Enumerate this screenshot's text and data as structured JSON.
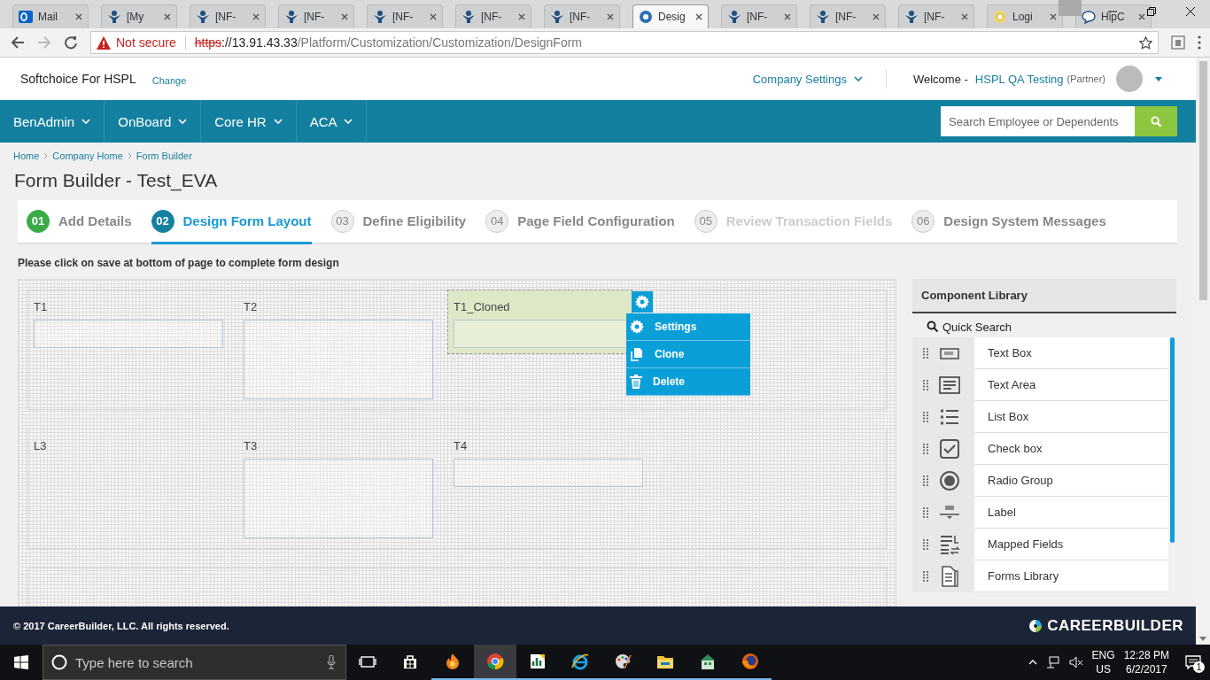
{
  "browser": {
    "tabs": [
      {
        "label": "Mail",
        "kind": "mail",
        "selected": false
      },
      {
        "label": "[My",
        "kind": "tracker",
        "selected": false
      },
      {
        "label": "[NF-",
        "kind": "tracker",
        "selected": false
      },
      {
        "label": "[NF-",
        "kind": "tracker",
        "selected": false
      },
      {
        "label": "[NF-",
        "kind": "tracker",
        "selected": false
      },
      {
        "label": "[NF-",
        "kind": "tracker",
        "selected": false
      },
      {
        "label": "[NF-",
        "kind": "tracker",
        "selected": false
      },
      {
        "label": "Desig",
        "kind": "site",
        "selected": true
      },
      {
        "label": "[NF-",
        "kind": "tracker",
        "selected": false
      },
      {
        "label": "[NF-",
        "kind": "tracker",
        "selected": false
      },
      {
        "label": "[NF-",
        "kind": "tracker",
        "selected": false
      },
      {
        "label": "Logi",
        "kind": "login",
        "selected": false
      },
      {
        "label": "HipC",
        "kind": "chat",
        "selected": false
      }
    ],
    "security": "Not secure",
    "url_scheme": "https",
    "url_host": "://13.91.43.33",
    "url_path": "/Platform/Customization/Customization/DesignForm"
  },
  "header": {
    "company": "Softchoice For HSPL",
    "change": "Change",
    "company_settings": "Company Settings",
    "welcome": "Welcome -",
    "user": "HSPL QA Testing",
    "role": "(Partner)"
  },
  "nav": {
    "items": [
      "BenAdmin",
      "OnBoard",
      "Core HR",
      "ACA"
    ],
    "search_placeholder": "Search Employee or Dependents"
  },
  "breadcrumb": [
    "Home",
    "Company Home",
    "Form Builder"
  ],
  "page_title": "Form Builder - Test_EVA",
  "steps": [
    {
      "number": "01",
      "label": "Add Details",
      "kind": "complete",
      "selected": false
    },
    {
      "number": "02",
      "label": "Design Form Layout",
      "kind": "current",
      "selected": true
    },
    {
      "number": "03",
      "label": "Define Eligibility",
      "kind": "pending",
      "selected": false
    },
    {
      "number": "04",
      "label": "Page Field Configuration",
      "kind": "pending",
      "selected": false
    },
    {
      "number": "05",
      "label": "Review Transaction Fields",
      "kind": "disabled",
      "selected": false
    },
    {
      "number": "06",
      "label": "Design System Messages",
      "kind": "pending",
      "selected": false
    }
  ],
  "instruction": "Please click on save at bottom of page to complete form design",
  "canvas": {
    "rows": [
      {
        "kind": "fields",
        "fields": [
          {
            "label": "T1",
            "kind": "textbox",
            "selected": false
          },
          {
            "label": "T2",
            "kind": "textarea",
            "selected": false
          },
          {
            "label": "T1_Cloned",
            "kind": "textbox",
            "selected": true
          }
        ]
      },
      {
        "kind": "fields",
        "fields": [
          {
            "label": "L3",
            "kind": "label",
            "selected": false
          },
          {
            "label": "T3",
            "kind": "textarea",
            "selected": false
          },
          {
            "label": "T4",
            "kind": "textbox",
            "selected": false
          }
        ]
      },
      {
        "kind": "empty"
      }
    ],
    "context_menu": [
      {
        "label": "Settings",
        "kind": "settings"
      },
      {
        "label": "Clone",
        "kind": "clone"
      },
      {
        "label": "Delete",
        "kind": "delete"
      }
    ]
  },
  "library": {
    "title": "Component Library",
    "search_label": "Quick Search",
    "items": [
      {
        "label": "Text Box",
        "kind": "textbox"
      },
      {
        "label": "Text Area",
        "kind": "textarea"
      },
      {
        "label": "List Box",
        "kind": "listbox"
      },
      {
        "label": "Check box",
        "kind": "checkbox"
      },
      {
        "label": "Radio Group",
        "kind": "radio"
      },
      {
        "label": "Label",
        "kind": "label"
      },
      {
        "label": "Mapped Fields",
        "kind": "mapped"
      },
      {
        "label": "Forms Library",
        "kind": "forms"
      }
    ]
  },
  "footer": {
    "copyright": "© 2017 CareerBuilder, LLC. All rights reserved.",
    "logo": "CAREERBUILDER"
  },
  "taskbar": {
    "search_placeholder": "Type here to search",
    "apps": [
      {
        "kind": "taskview",
        "open": false,
        "selected": false
      },
      {
        "kind": "store",
        "open": false,
        "selected": false
      },
      {
        "kind": "flame",
        "open": true,
        "selected": false
      },
      {
        "kind": "chrome",
        "open": true,
        "selected": true
      },
      {
        "kind": "sheet",
        "open": true,
        "selected": false
      },
      {
        "kind": "ie",
        "open": true,
        "selected": false
      },
      {
        "kind": "paint",
        "open": true,
        "selected": false
      },
      {
        "kind": "folder",
        "open": true,
        "selected": false
      },
      {
        "kind": "green",
        "open": true,
        "selected": false
      },
      {
        "kind": "firefox",
        "open": true,
        "selected": false
      }
    ],
    "language": "ENG",
    "region": "US",
    "time": "12:28 PM",
    "date": "6/2/2017",
    "notifications": "1"
  }
}
